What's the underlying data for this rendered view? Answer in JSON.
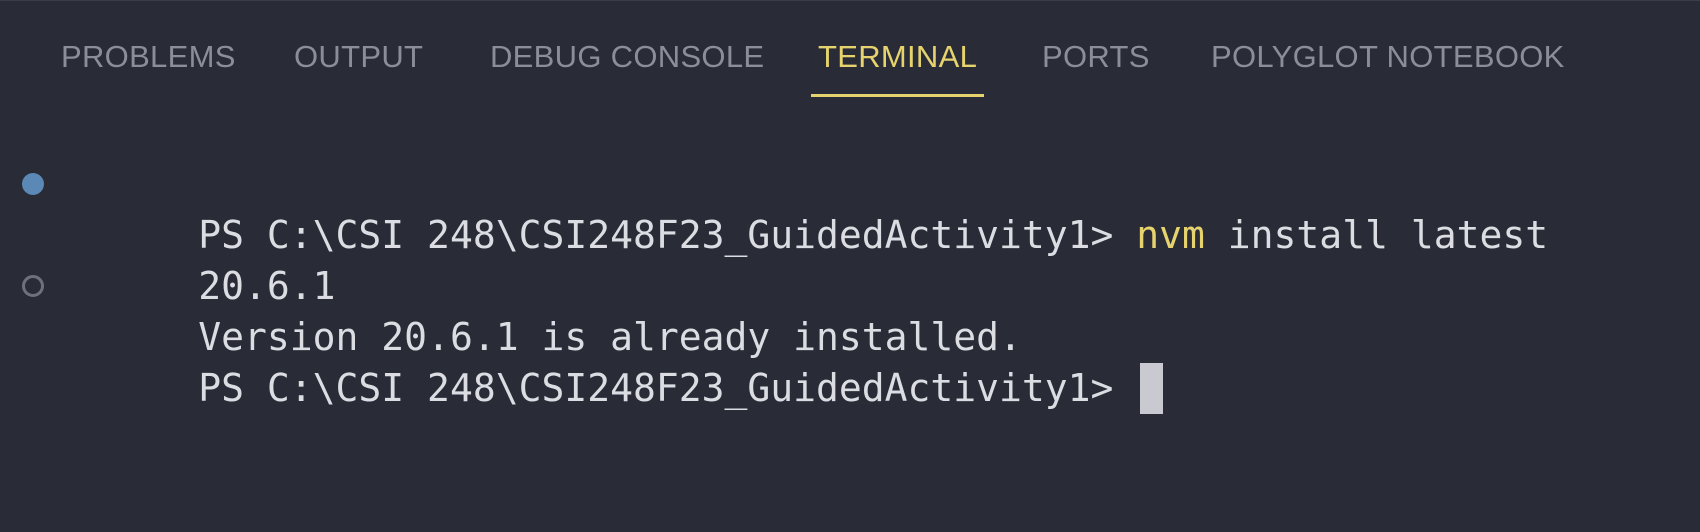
{
  "tabs": [
    {
      "label": "PROBLEMS",
      "active": false
    },
    {
      "label": "OUTPUT",
      "active": false
    },
    {
      "label": "DEBUG CONSOLE",
      "active": false
    },
    {
      "label": "TERMINAL",
      "active": true
    },
    {
      "label": "PORTS",
      "active": false
    },
    {
      "label": "POLYGLOT NOTEBOOK",
      "active": false
    }
  ],
  "terminal": {
    "prompt1": "PS C:\\CSI 248\\CSI248F23_GuidedActivity1> ",
    "command_name": "nvm",
    "command_args": " install latest",
    "output1": "20.6.1",
    "output2": "Version 20.6.1 is already installed.",
    "prompt2": "PS C:\\CSI 248\\CSI248F23_GuidedActivity1> "
  },
  "colors": {
    "background": "#292c37",
    "active_tab": "#e6d36e",
    "inactive_tab": "#8b8e98",
    "command_highlight": "#e6d36e",
    "decoration_success": "#5b88b5"
  }
}
